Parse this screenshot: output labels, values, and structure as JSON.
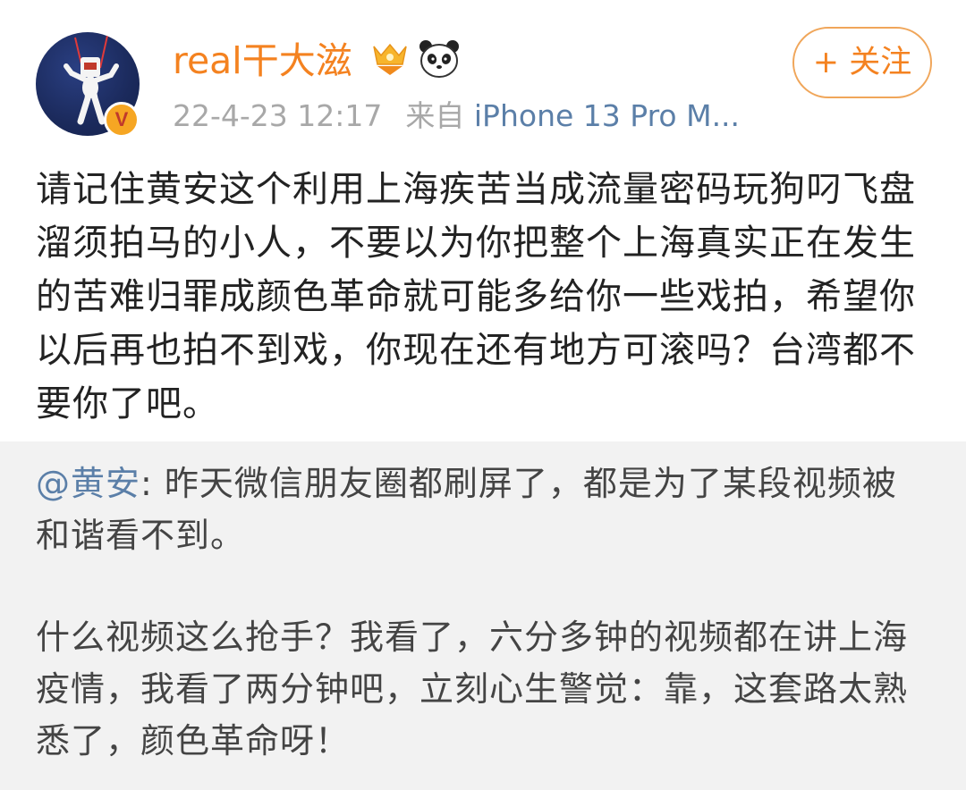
{
  "author": {
    "name": "real干大滋",
    "verified_mark": "V",
    "icons": [
      "vip-crown-icon",
      "panda-icon"
    ]
  },
  "meta": {
    "timestamp": "22-4-23 12:17",
    "source_prefix": "来自",
    "device": "iPhone 13 Pro M..."
  },
  "follow_button": {
    "label": "+ 关注"
  },
  "post": {
    "text": "请记住黄安这个利用上海疾苦当成流量密码玩狗叼飞盘溜须拍马的小人，不要以为你把整个上海真实正在发生的苦难归罪成颜色革命就可能多给你一些戏拍，希望你以后再也拍不到戏，你现在还有地方可滚吗？台湾都不要你了吧。"
  },
  "repost": {
    "mention": "@黄安",
    "text_1": ": 昨天微信朋友圈都刷屏了，都是为了某段视频被和谐看不到。",
    "text_2": "什么视频这么抢手？我看了，六分多钟的视频都在讲上海疫情，我看了两分钟吧，立刻心生警觉：靠，这套路太熟悉了，颜色革命呀！"
  },
  "colors": {
    "username": "#f48220",
    "link": "#5b7fa8",
    "repost_bg": "#f2f2f2"
  }
}
